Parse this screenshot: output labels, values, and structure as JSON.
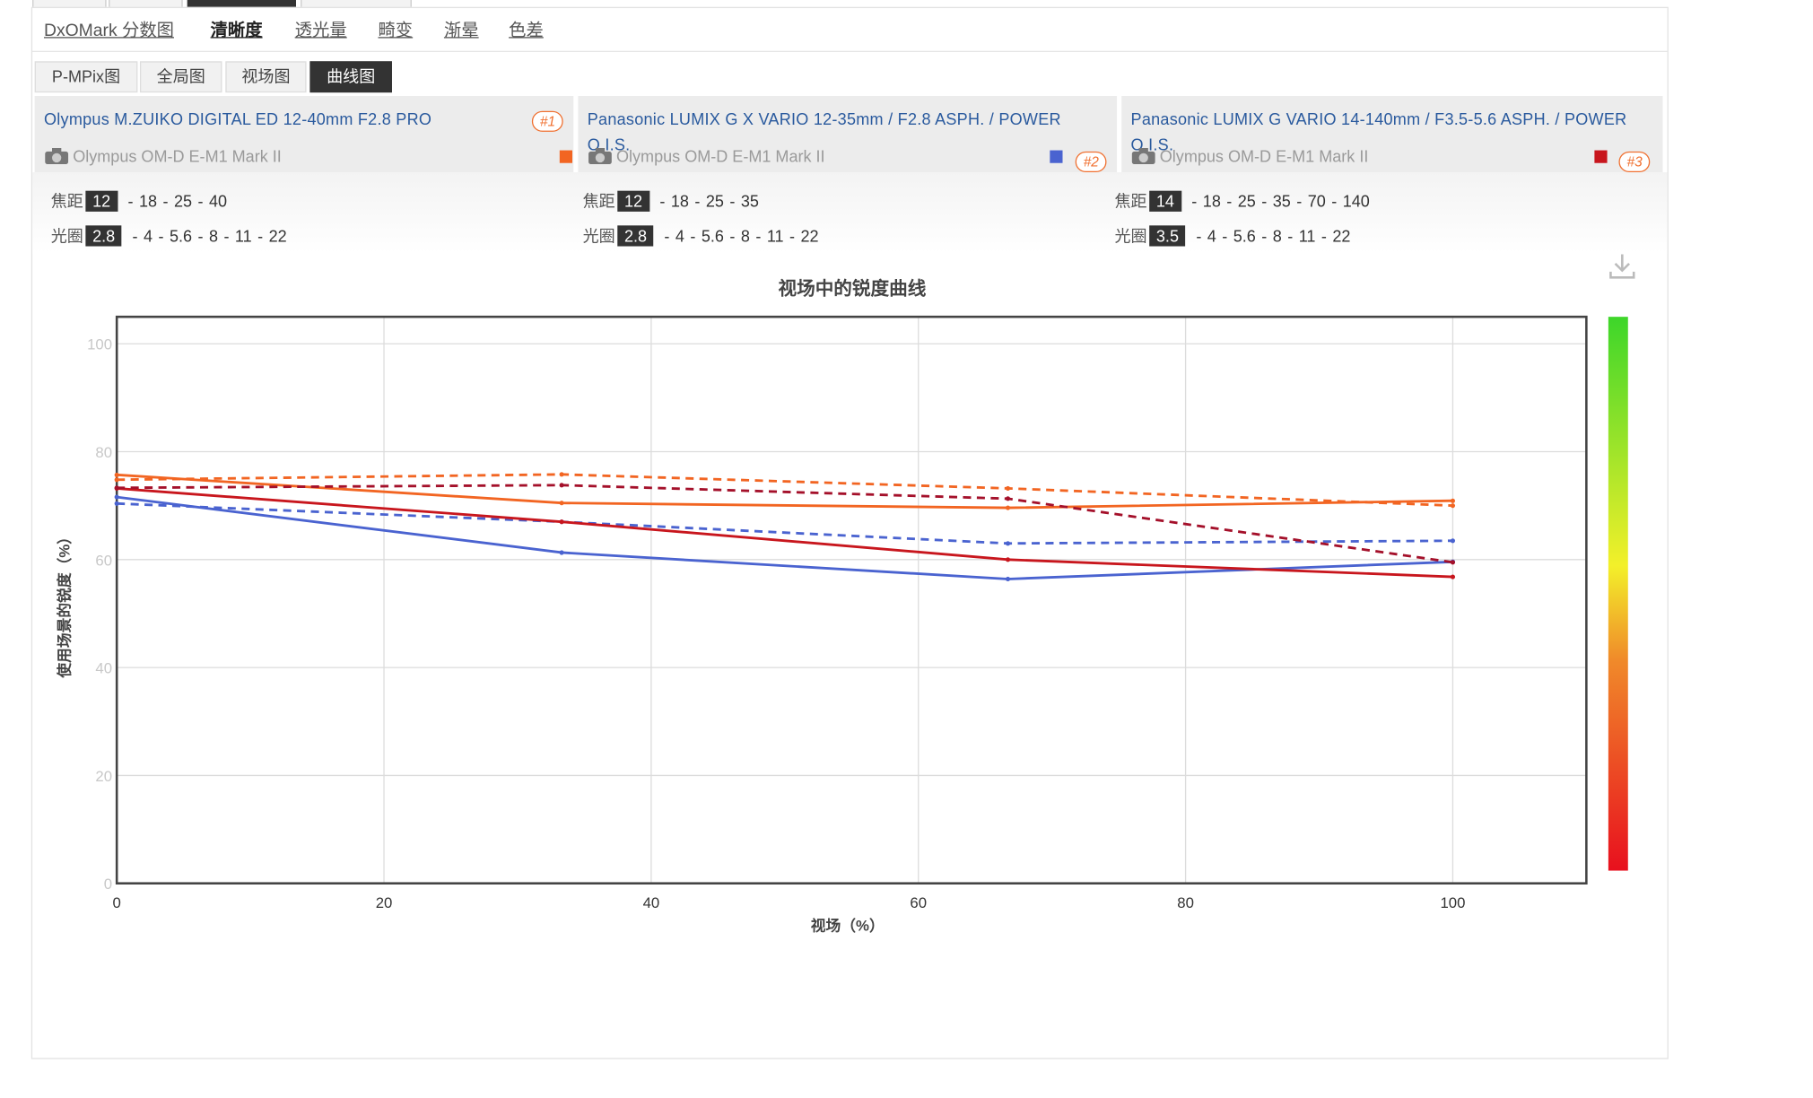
{
  "category_tabs": [
    {
      "label": "DxOMark 分数图",
      "active": false
    },
    {
      "label": "清晰度",
      "active": true
    },
    {
      "label": "透光量",
      "active": false
    },
    {
      "label": "畸变",
      "active": false
    },
    {
      "label": "渐晕",
      "active": false
    },
    {
      "label": "色差",
      "active": false
    }
  ],
  "sub_tabs": [
    {
      "label": "P-MPix图",
      "active": false
    },
    {
      "label": "全局图",
      "active": false
    },
    {
      "label": "视场图",
      "active": false
    },
    {
      "label": "曲线图",
      "active": true
    }
  ],
  "lenses": [
    {
      "name_line1": "Olympus M.ZUIKO DIGITAL ED 12-40mm F2.8 PRO",
      "name_line2": "",
      "camera": "Olympus OM-D E-M1 Mark II",
      "rank": "#1",
      "color": "#f26522",
      "focal_label": "焦距",
      "focal_selected": "12",
      "focal_others": [
        "18",
        "25",
        "40"
      ],
      "aperture_label": "光圈",
      "aperture_selected": "2.8",
      "aperture_others": [
        "4",
        "5.6",
        "8",
        "11",
        "22"
      ]
    },
    {
      "name_line1": "Panasonic LUMIX G X VARIO 12-35mm / F2.8 ASPH. / POWER",
      "name_line2": "O.I.S.",
      "camera": "Olympus OM-D E-M1 Mark II",
      "rank": "#2",
      "color": "#4a63d0",
      "focal_label": "焦距",
      "focal_selected": "12",
      "focal_others": [
        "18",
        "25",
        "35"
      ],
      "aperture_label": "光圈",
      "aperture_selected": "2.8",
      "aperture_others": [
        "4",
        "5.6",
        "8",
        "11",
        "22"
      ]
    },
    {
      "name_line1": "Panasonic LUMIX G VARIO 14-140mm / F3.5-5.6 ASPH. / POWER",
      "name_line2": "O.I.S.",
      "camera": "Olympus OM-D E-M1 Mark II",
      "rank": "#3",
      "color": "#c8161d",
      "focal_label": "焦距",
      "focal_selected": "14",
      "focal_others": [
        "18",
        "25",
        "35",
        "70",
        "140"
      ],
      "aperture_label": "光圈",
      "aperture_selected": "3.5",
      "aperture_others": [
        "4",
        "5.6",
        "8",
        "11",
        "22"
      ]
    }
  ],
  "download_icon": "download-icon",
  "chart_data": {
    "type": "line",
    "title": "视场中的锐度曲线",
    "xlabel": "视场（%）",
    "ylabel": "使用场景的锐度（%）",
    "xlim": [
      0,
      110
    ],
    "ylim": [
      0,
      105
    ],
    "x_ticks": [
      "0",
      "20",
      "40",
      "60",
      "80",
      "100"
    ],
    "y_ticks": [
      "0",
      "20",
      "40",
      "60",
      "80",
      "100"
    ],
    "grid": true,
    "legend": "none",
    "color_scale": {
      "top": "#3dd62a",
      "middle": "#f3f02a",
      "bottom": "#e8101e"
    },
    "series": [
      {
        "color": "#f26522",
        "dash": false,
        "x": [
          0,
          33.3,
          66.7,
          100
        ],
        "y": [
          75.7,
          70.5,
          69.6,
          70.9
        ]
      },
      {
        "color": "#f26522",
        "dash": true,
        "x": [
          0,
          33.3,
          66.7,
          100
        ],
        "y": [
          74.8,
          75.8,
          73.2,
          70.0
        ]
      },
      {
        "color": "#4a63d0",
        "dash": false,
        "x": [
          0,
          33.3,
          66.7,
          100
        ],
        "y": [
          71.6,
          61.3,
          56.4,
          59.6
        ]
      },
      {
        "color": "#4a63d0",
        "dash": true,
        "x": [
          0,
          33.3,
          66.7,
          100
        ],
        "y": [
          70.4,
          67.0,
          63.0,
          63.5
        ]
      },
      {
        "color": "#c8161d",
        "dash": false,
        "x": [
          0,
          33.3,
          66.7,
          100
        ],
        "y": [
          73.2,
          67.0,
          60.0,
          56.8
        ]
      },
      {
        "color": "#a4102a",
        "dash": true,
        "x": [
          0,
          33.3,
          66.7,
          100
        ],
        "y": [
          73.3,
          73.8,
          71.3,
          59.5
        ]
      }
    ]
  }
}
